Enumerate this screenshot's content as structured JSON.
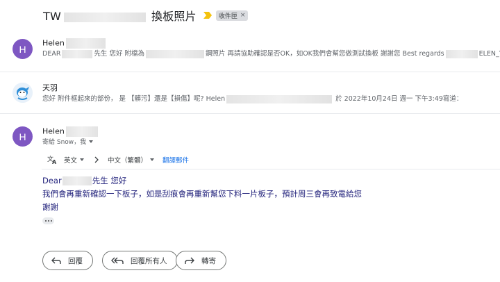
{
  "subject": {
    "prefix": "TW",
    "title": "換板照片",
    "label": "收件匣",
    "label_close": "×"
  },
  "messages": [
    {
      "avatar_letter": "H",
      "sender": "Helen",
      "snippet_a": "DEAR",
      "snippet_b": "先生 您好 附檔為",
      "snippet_c": "鋼照片 再請協助確認是否OK，如OK我們會幫您做測試換板 謝謝您 Best regards",
      "snippet_d": "ELEN_Y"
    },
    {
      "sender": "天羽",
      "snippet_a": "您好 附件框起來的部份， 是 【髒污】還是【損傷】呢? Helen",
      "snippet_b": " 於 2022年10月24日 週一 下午3:49寫道："
    },
    {
      "avatar_letter": "H",
      "sender": "Helen",
      "to_line": "寄給 Snow，我"
    }
  ],
  "translate": {
    "from_icon": "translate-icon",
    "from_lang": "英文",
    "to_lang": "中文（繁體）",
    "link": "翻譯郵件"
  },
  "body": {
    "greeting_a": "Dear",
    "greeting_b": "先生 您好",
    "line2": "我們會再重新確認一下板子，如是刮痕會再重新幫您下料一片板子，預計周三會再致電給您",
    "line3": "謝謝"
  },
  "actions": {
    "reply": "回覆",
    "reply_all": "回覆所有人",
    "forward": "轉寄"
  },
  "colors": {
    "avatar_purple": "#7e57c2",
    "label_gray": "#dadce0",
    "link_blue": "#1a73e8",
    "importance_yellow": "#f4c20d"
  }
}
